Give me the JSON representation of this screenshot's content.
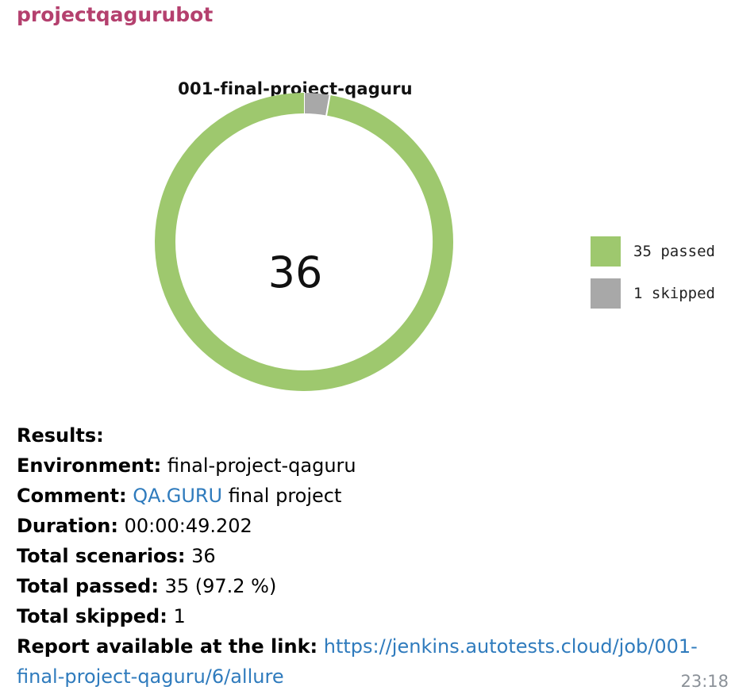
{
  "message": {
    "sender": "projectqagurubot",
    "timestamp": "23:18"
  },
  "chart_data": {
    "type": "pie",
    "title": "001-final-project-qaguru",
    "center_label": "36",
    "categories": [
      "passed",
      "skipped"
    ],
    "values": [
      35,
      1
    ],
    "colors": [
      "#9ec86e",
      "#a8a8a8"
    ],
    "legend": [
      "35 passed",
      "1 skipped"
    ],
    "legend_placement": "right",
    "donut": true
  },
  "results": {
    "heading": "Results:",
    "environment_label": "Environment:",
    "environment_value": "final-project-qaguru",
    "comment_label": "Comment:",
    "comment_link": "QA.GURU",
    "comment_rest": "final project",
    "duration_label": "Duration:",
    "duration_value": "00:00:49.202",
    "total_scenarios_label": "Total scenarios:",
    "total_scenarios_value": "36",
    "total_passed_label": "Total passed:",
    "total_passed_value": "35 (97.2 %)",
    "total_skipped_label": "Total skipped:",
    "total_skipped_value": "1",
    "report_label": "Report available at the link:",
    "report_link_part1": "https://jenkins.autotests.cloud/job/001-",
    "report_link_part2": "final-project-qaguru/6/allure"
  },
  "colors": {
    "sender": "#b4406e",
    "link": "#2f7bbd",
    "timestamp": "#8b9198"
  }
}
